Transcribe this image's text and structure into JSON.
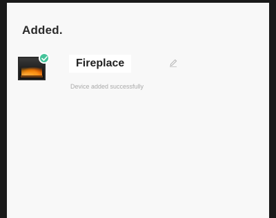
{
  "header": {
    "title": "Added."
  },
  "device": {
    "name": "Fireplace",
    "status": "Device added successfully",
    "thumbnail_icon": "fireplace-thumbnail",
    "badge_icon": "check-icon",
    "edit_icon": "pencil-icon"
  },
  "colors": {
    "success_badge": "#45c39a",
    "status_text": "#a9a9a9",
    "heading_text": "#2b2b2b"
  }
}
